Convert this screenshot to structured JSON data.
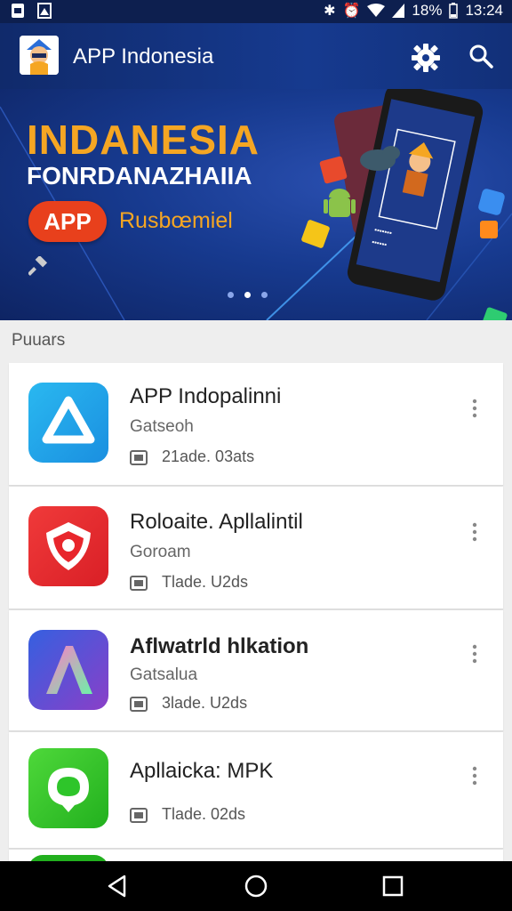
{
  "status_bar": {
    "battery": "18%",
    "time": "13:24",
    "icons": [
      "notification-icon",
      "gallery-icon",
      "bluetooth-icon",
      "alarm-icon",
      "wifi-icon",
      "signal-icon",
      "battery-icon"
    ]
  },
  "app_bar": {
    "title": "APP Indonesia",
    "actions": [
      "gear-icon",
      "search-icon"
    ]
  },
  "banner": {
    "title": "INDANESIA",
    "subtitle": "FONRDANAZHAIIA",
    "pill_label": "APP",
    "pill_caption": "Rusbœmiel",
    "slides": 3,
    "active_slide": 1
  },
  "section": {
    "label": "Puuars"
  },
  "apps": [
    {
      "name": "APP Indopalinni",
      "developer": "Gatseoh",
      "meta": "21ade. 03ats",
      "icon_color": "#1aa3e8"
    },
    {
      "name": "Roloaite. Apllalintil",
      "developer": "Goroam",
      "meta": "Tlade. U2ds",
      "icon_color": "#e8262c"
    },
    {
      "name": "Aflwatrld hlkation",
      "developer": "Gatsalua",
      "meta": "3lade. U2ds",
      "icon_color": "#7b3fc4"
    },
    {
      "name": "Apllaicka: MPK",
      "developer": "",
      "meta": "Tlade. 02ds",
      "icon_color": "#2ec52a"
    }
  ],
  "colors": {
    "primary": "#163a8f",
    "accent": "#f5a623",
    "pill": "#e8401c"
  }
}
